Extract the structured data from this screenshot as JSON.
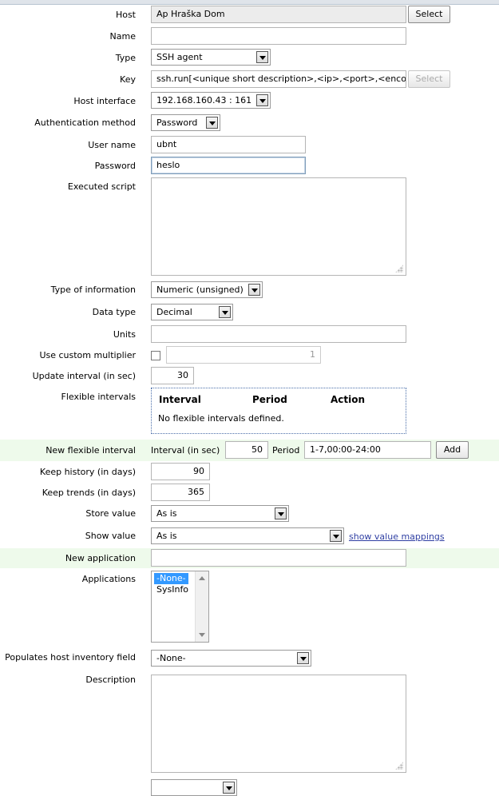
{
  "form": {
    "host": {
      "label": "Host",
      "value": "Ap Hraška Dom",
      "button": "Select"
    },
    "name": {
      "label": "Name",
      "value": ""
    },
    "type": {
      "label": "Type",
      "value": "SSH agent"
    },
    "key": {
      "label": "Key",
      "value": "ssh.run[<unique short description>,<ip>,<port>,<encoding>]",
      "button": "Select"
    },
    "host_interface": {
      "label": "Host interface",
      "value": "192.168.160.43 : 161"
    },
    "auth_method": {
      "label": "Authentication method",
      "value": "Password"
    },
    "user_name": {
      "label": "User name",
      "value": "ubnt"
    },
    "password": {
      "label": "Password",
      "value": "heslo"
    },
    "executed_script": {
      "label": "Executed script",
      "value": ""
    },
    "type_of_information": {
      "label": "Type of information",
      "value": "Numeric (unsigned)"
    },
    "data_type": {
      "label": "Data type",
      "value": "Decimal"
    },
    "units": {
      "label": "Units",
      "value": ""
    },
    "custom_multiplier": {
      "label": "Use custom multiplier",
      "checked": false,
      "value": "1"
    },
    "update_interval": {
      "label": "Update interval (in sec)",
      "value": "30"
    },
    "flexible_intervals": {
      "label": "Flexible intervals",
      "columns": [
        "Interval",
        "Period",
        "Action"
      ],
      "empty_message": "No flexible intervals defined."
    },
    "new_flexible_interval": {
      "label": "New flexible interval",
      "interval_label": "Interval (in sec)",
      "interval_value": "50",
      "period_label": "Period",
      "period_value": "1-7,00:00-24:00",
      "button": "Add"
    },
    "keep_history": {
      "label": "Keep history (in days)",
      "value": "90"
    },
    "keep_trends": {
      "label": "Keep trends (in days)",
      "value": "365"
    },
    "store_value": {
      "label": "Store value",
      "value": "As is"
    },
    "show_value": {
      "label": "Show value",
      "value": "As is",
      "link": "show value mappings"
    },
    "new_application": {
      "label": "New application",
      "value": ""
    },
    "applications": {
      "label": "Applications",
      "options": [
        "-None-",
        "SysInfo"
      ],
      "selected": "-None-"
    },
    "inventory_field": {
      "label": "Populates host inventory field",
      "value": "-None-"
    },
    "description": {
      "label": "Description",
      "value": ""
    }
  }
}
